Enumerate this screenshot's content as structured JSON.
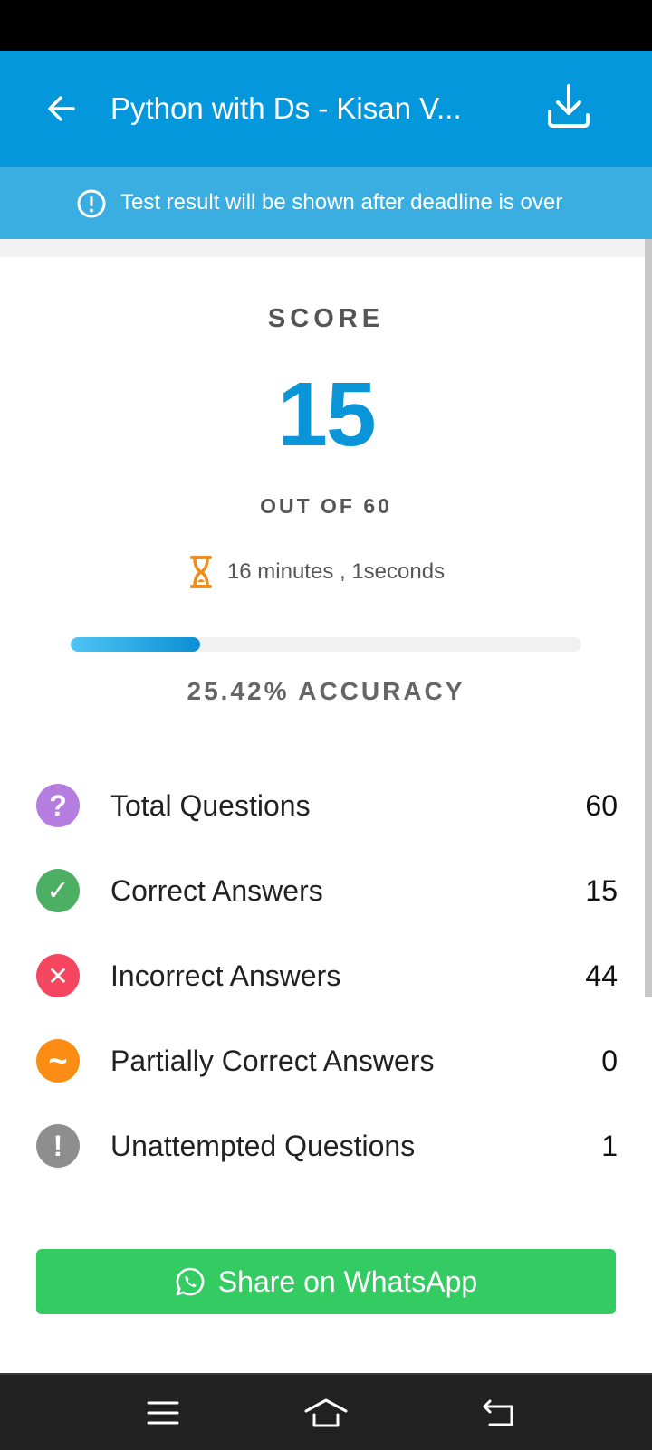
{
  "header": {
    "title": "Python with Ds - Kisan V...",
    "back_icon": "arrow-left-icon",
    "download_icon": "download-icon",
    "color": "#0497dc"
  },
  "banner": {
    "text": "Test result will be shown after deadline is over",
    "icon": "info-icon",
    "color": "#3aaee1"
  },
  "score": {
    "label": "SCORE",
    "value": "15",
    "out_of": "OUT OF 60",
    "time_taken": "16 minutes , 1seconds",
    "time_icon": "hourglass-icon",
    "accuracy_text": "25.42% ACCURACY",
    "accuracy_fraction": 0.2542,
    "accent": "#0a95d9"
  },
  "stats": [
    {
      "label": "Total Questions",
      "value": "60",
      "icon": "question-icon",
      "symbol": "?",
      "color": "#b57de0"
    },
    {
      "label": "Correct Answers",
      "value": "15",
      "icon": "check-icon",
      "symbol": "✓",
      "color": "#4caf64"
    },
    {
      "label": "Incorrect Answers",
      "value": "44",
      "icon": "cross-icon",
      "symbol": "✕",
      "color": "#f4475f"
    },
    {
      "label": "Partially Correct Answers",
      "value": "0",
      "icon": "tilde-icon",
      "symbol": "~",
      "color": "#fb8c14"
    },
    {
      "label": "Unattempted Questions",
      "value": "1",
      "icon": "exclamation-icon",
      "symbol": "!",
      "color": "#8e8e8e"
    }
  ],
  "share": {
    "label": "Share on WhatsApp",
    "icon": "whatsapp-icon",
    "color": "#34cb63"
  },
  "navbar": {
    "menu_icon": "menu-icon",
    "home_icon": "home-icon",
    "back_icon": "back-icon"
  }
}
